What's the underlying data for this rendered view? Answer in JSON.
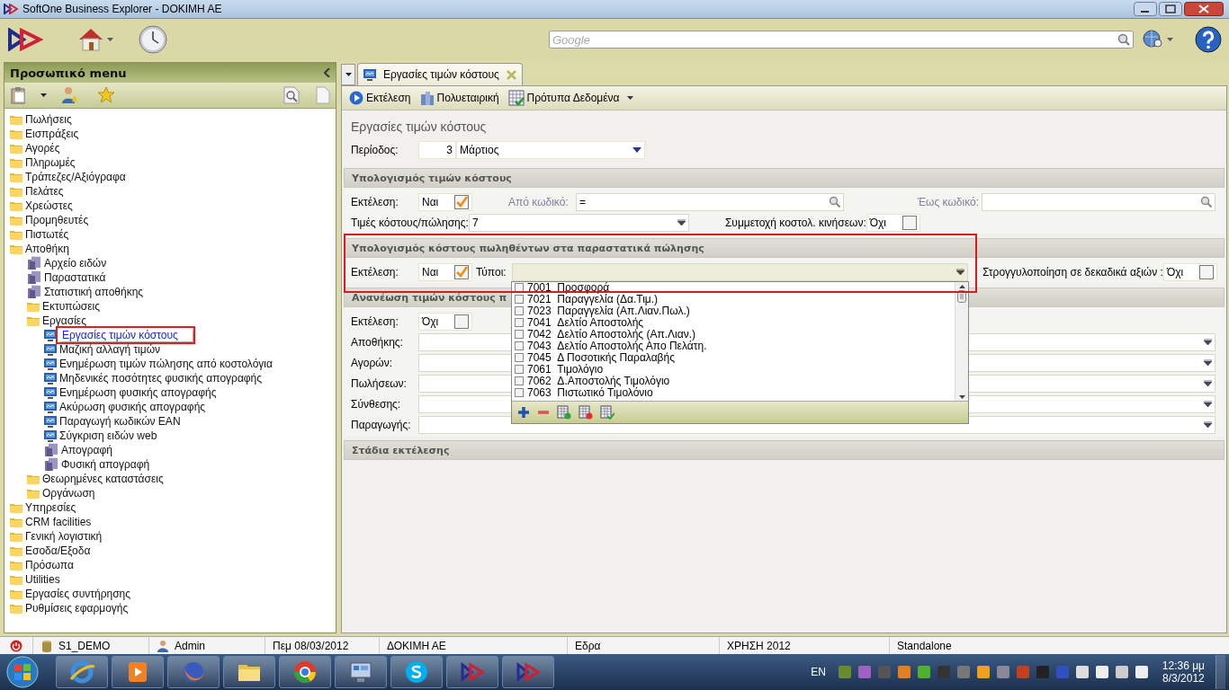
{
  "window": {
    "title": "SoftOne Business Explorer - DOKIMH AE"
  },
  "toolbar": {
    "search": {
      "placeholder": "Google"
    }
  },
  "sidebar": {
    "title": "Προσωπικό menu",
    "items": [
      {
        "kind": "folder",
        "label": "Πωλήσεις",
        "selected": false
      },
      {
        "kind": "folder",
        "label": "Εισπράξεις",
        "selected": false
      },
      {
        "kind": "folder",
        "label": "Αγορές",
        "selected": false
      },
      {
        "kind": "folder",
        "label": "Πληρωμές",
        "selected": false
      },
      {
        "kind": "folder",
        "label": "Τράπεζες/Αξιόγραφα",
        "selected": false
      },
      {
        "kind": "folder",
        "label": "Πελάτες",
        "selected": false
      },
      {
        "kind": "folder",
        "label": "Χρεώστες",
        "selected": false
      },
      {
        "kind": "folder",
        "label": "Προμηθευτές",
        "selected": false
      },
      {
        "kind": "folder",
        "label": "Πιστωτές",
        "selected": false
      },
      {
        "kind": "folder",
        "label": "Αποθήκη",
        "selected": false,
        "children": [
          {
            "kind": "module",
            "label": "Αρχείο ειδών",
            "selected": false
          },
          {
            "kind": "module",
            "label": "Παραστατικά",
            "selected": false
          },
          {
            "kind": "module",
            "label": "Στατιστική αποθήκης",
            "selected": false
          },
          {
            "kind": "folder",
            "label": "Εκτυπώσεις",
            "selected": false
          },
          {
            "kind": "folder",
            "label": "Εργασίες",
            "selected": false,
            "children": [
              {
                "kind": "job",
                "label": "Εργασίες τιμών κόστους",
                "selected": true
              },
              {
                "kind": "job",
                "label": "Μαζική αλλαγή τιμών",
                "selected": false
              },
              {
                "kind": "job",
                "label": "Ενημέρωση τιμών πώλησης από κοστολόγια",
                "selected": false
              },
              {
                "kind": "job",
                "label": "Μηδενικές ποσότητες φυσικής απογραφής",
                "selected": false
              },
              {
                "kind": "job",
                "label": "Ενημέρωση φυσικής απογραφής",
                "selected": false
              },
              {
                "kind": "job",
                "label": "Ακύρωση φυσικής απογραφής",
                "selected": false
              },
              {
                "kind": "job",
                "label": "Παραγωγή κωδικών EAN",
                "selected": false
              },
              {
                "kind": "job",
                "label": "Σύγκριση ειδών web",
                "selected": false
              },
              {
                "kind": "module",
                "label": "Απογραφή",
                "selected": false
              },
              {
                "kind": "module",
                "label": "Φυσική απογραφή",
                "selected": false
              }
            ]
          },
          {
            "kind": "folder",
            "label": "Θεωρημένες καταστάσεις",
            "selected": false
          },
          {
            "kind": "folder",
            "label": "Οργάνωση",
            "selected": false
          }
        ]
      },
      {
        "kind": "folder",
        "label": "Υπηρεσίες",
        "selected": false
      },
      {
        "kind": "folder",
        "label": "CRM facilities",
        "selected": false
      },
      {
        "kind": "folder",
        "label": "Γενική λογιστική",
        "selected": false
      },
      {
        "kind": "folder",
        "label": "Εσοδα/Εξοδα",
        "selected": false
      },
      {
        "kind": "folder",
        "label": "Πρόσωπα",
        "selected": false
      },
      {
        "kind": "folder",
        "label": "Utilities",
        "selected": false
      },
      {
        "kind": "folder",
        "label": "Εργασίες συντήρησης",
        "selected": false
      },
      {
        "kind": "folder",
        "label": "Ρυθμίσεις εφαρμογής",
        "selected": false
      }
    ]
  },
  "tabs": [
    {
      "label": "Εργασίες τιμών κόστους",
      "selected": true
    }
  ],
  "actions": [
    {
      "kind": "run",
      "label": "Εκτέλεση"
    },
    {
      "kind": "company",
      "label": "Πολυεταιρική"
    },
    {
      "kind": "template",
      "label": "Πρότυπα Δεδομένα"
    }
  ],
  "form": {
    "title": "Εργασίες τιμών κόστους",
    "period": {
      "label": "Περίοδος:",
      "number": "3",
      "month": "Μάρτιος"
    },
    "sections": [
      {
        "title": "Υπολογισμός τιμών κόστους",
        "rows": [
          [
            {
              "kind": "check",
              "label": "Εκτέλεση:",
              "value": "Ναι",
              "checked": true
            },
            {
              "kind": "search",
              "label": "Από κωδικό:",
              "value": "=",
              "disabled": true
            },
            {
              "kind": "search",
              "label": "Έως κωδικό:",
              "disabled": true
            }
          ],
          [
            {
              "kind": "combo",
              "label": "Τιμές κόστους/πώλησης:",
              "value": "7"
            },
            {
              "kind": "check",
              "label": "Συμμετοχή κοστολ. κινήσεων:",
              "value": "Όχι",
              "checked": false
            }
          ]
        ]
      },
      {
        "title": "Υπολογισμός κόστους πωληθέντων στα παραστατικά πώλησης",
        "highlighted": true,
        "rows": [
          [
            {
              "kind": "check",
              "label": "Εκτέλεση:",
              "value": "Ναι",
              "checked": true
            },
            {
              "kind": "multi",
              "label": "Τύποι:",
              "open": true,
              "options": [
                {
                  "code": "7001",
                  "name": "Προσφορά",
                  "checked": false
                },
                {
                  "code": "7021",
                  "name": "Παραγγελία (Δα.Τιμ.)",
                  "checked": false
                },
                {
                  "code": "7023",
                  "name": "Παραγγελία (Απ.Λιαν.Πωλ.)",
                  "checked": false
                },
                {
                  "code": "7041",
                  "name": "Δελτίο Αποστολής",
                  "checked": false
                },
                {
                  "code": "7042",
                  "name": "Δελτίο Αποστολής (Απ.Λιαν.)",
                  "checked": false
                },
                {
                  "code": "7043",
                  "name": "Δελτίο Αποστολής Απο Πελάτη.",
                  "checked": false
                },
                {
                  "code": "7045",
                  "name": "Δ Ποσοτικής Παραλαβής",
                  "checked": false
                },
                {
                  "code": "7061",
                  "name": "Τιμολόγιο",
                  "checked": false
                },
                {
                  "code": "7062",
                  "name": "Δ.Αποστολής Τιμολόγιο",
                  "checked": false
                },
                {
                  "code": "7063",
                  "name": "Πιστωτικό Τιμολόνιο",
                  "checked": false
                }
              ]
            },
            {
              "kind": "check",
              "label": "Στρογγυλοποίηση σε δεκαδικά αξιών :",
              "value": "Όχι",
              "checked": false
            }
          ]
        ]
      },
      {
        "title": "Ανανέωση τιμών κόστους π",
        "rows": [
          [
            {
              "kind": "check",
              "label": "Εκτέλεση:",
              "value": "Όχι",
              "checked": false
            }
          ],
          [
            {
              "kind": "combo",
              "label": "Αποθήκης:"
            }
          ],
          [
            {
              "kind": "combo",
              "label": "Αγορών:"
            }
          ],
          [
            {
              "kind": "combo",
              "label": "Πωλήσεων:"
            }
          ],
          [
            {
              "kind": "combo",
              "label": "Σύνθεσης:"
            }
          ],
          [
            {
              "kind": "combo",
              "label": "Παραγωγής:"
            }
          ]
        ]
      },
      {
        "title": "Στάδια εκτέλεσης"
      }
    ]
  },
  "status_bar": {
    "segments": [
      {
        "kind": "database",
        "text": "S1_DEMO"
      },
      {
        "kind": "user",
        "text": "Admin"
      },
      {
        "kind": "plain",
        "text": "Πεμ 08/03/2012"
      },
      {
        "kind": "plain",
        "text": "ΔΟΚΙΜΗ ΑΕ"
      },
      {
        "kind": "plain",
        "text": "Εδρα"
      },
      {
        "kind": "plain",
        "text": "ΧΡΗΣΗ 2012"
      },
      {
        "kind": "plain",
        "text": "Standalone"
      }
    ]
  },
  "taskbar": {
    "apps": [
      {
        "kind": "ie"
      },
      {
        "kind": "media"
      },
      {
        "kind": "firefox"
      },
      {
        "kind": "files"
      },
      {
        "kind": "chrome"
      },
      {
        "kind": "control"
      },
      {
        "kind": "skype"
      },
      {
        "kind": "softone"
      },
      {
        "kind": "softone"
      }
    ],
    "language": "EN",
    "time": "12:36 μμ",
    "date": "8/3/2012"
  }
}
